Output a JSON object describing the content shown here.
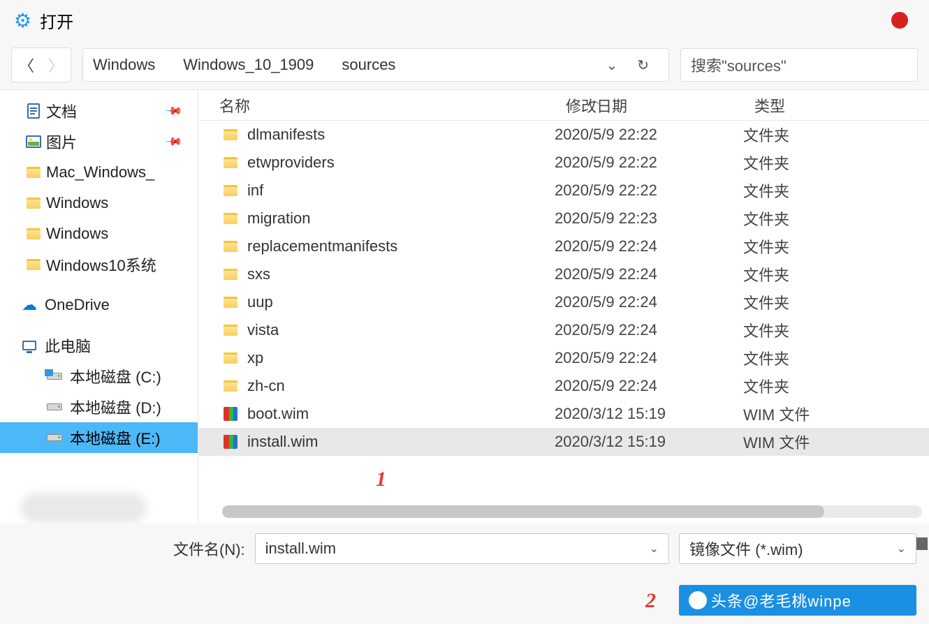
{
  "title": "打开",
  "breadcrumbs": [
    "Windows",
    "Windows_10_1909",
    "sources"
  ],
  "search_placeholder": "搜索\"sources\"",
  "sidebar": {
    "items": [
      {
        "label": "文档",
        "icon": "doc",
        "pinned": true
      },
      {
        "label": "图片",
        "icon": "pic",
        "pinned": true
      },
      {
        "label": "Mac_Windows_",
        "icon": "folder"
      },
      {
        "label": "Windows",
        "icon": "folder"
      },
      {
        "label": "Windows",
        "icon": "folder"
      },
      {
        "label": "Windows10系统",
        "icon": "folder"
      }
    ],
    "onedrive": "OneDrive",
    "thispc": "此电脑",
    "drives": [
      {
        "label": "本地磁盘 (C:)"
      },
      {
        "label": "本地磁盘 (D:)"
      },
      {
        "label": "本地磁盘 (E:)",
        "selected": true
      }
    ]
  },
  "columns": {
    "name": "名称",
    "date": "修改日期",
    "type": "类型"
  },
  "files": [
    {
      "name": "dlmanifests",
      "date": "2020/5/9 22:22",
      "type": "文件夹",
      "kind": "folder"
    },
    {
      "name": "etwproviders",
      "date": "2020/5/9 22:22",
      "type": "文件夹",
      "kind": "folder"
    },
    {
      "name": "inf",
      "date": "2020/5/9 22:22",
      "type": "文件夹",
      "kind": "folder"
    },
    {
      "name": "migration",
      "date": "2020/5/9 22:23",
      "type": "文件夹",
      "kind": "folder"
    },
    {
      "name": "replacementmanifests",
      "date": "2020/5/9 22:24",
      "type": "文件夹",
      "kind": "folder"
    },
    {
      "name": "sxs",
      "date": "2020/5/9 22:24",
      "type": "文件夹",
      "kind": "folder"
    },
    {
      "name": "uup",
      "date": "2020/5/9 22:24",
      "type": "文件夹",
      "kind": "folder"
    },
    {
      "name": "vista",
      "date": "2020/5/9 22:24",
      "type": "文件夹",
      "kind": "folder"
    },
    {
      "name": "xp",
      "date": "2020/5/9 22:24",
      "type": "文件夹",
      "kind": "folder"
    },
    {
      "name": "zh-cn",
      "date": "2020/5/9 22:24",
      "type": "文件夹",
      "kind": "folder"
    },
    {
      "name": "boot.wim",
      "date": "2020/3/12 15:19",
      "type": "WIM 文件",
      "kind": "wim"
    },
    {
      "name": "install.wim",
      "date": "2020/3/12 15:19",
      "type": "WIM 文件",
      "kind": "wim",
      "selected": true
    }
  ],
  "filename_label": "文件名(N):",
  "filename_value": "install.wim",
  "filter_value": "镜像文件 (*.wim)",
  "watermark": "头条@老毛桃winpe",
  "annotations": {
    "a1": "1",
    "a2": "2"
  }
}
